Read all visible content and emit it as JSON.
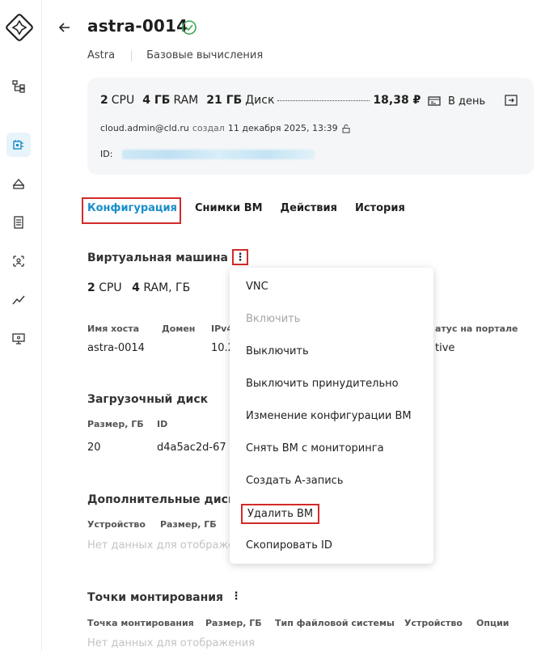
{
  "header": {
    "title": "astra-0014",
    "breadcrumb": [
      "Astra",
      "Базовые вычисления"
    ]
  },
  "summary": {
    "cpu_value": "2",
    "cpu_unit": "CPU",
    "ram_value": "4 ГБ",
    "ram_unit": "RAM",
    "disk_value": "21 ГБ",
    "disk_unit": "Диск",
    "price": "18,38 ₽",
    "period": "В день",
    "owner": "cloud.admin@cld.ru",
    "created_label": "создал",
    "created_date": "11 декабря 2025, 13:39",
    "id_label": "ID:"
  },
  "tabs": [
    {
      "label": "Конфигурация",
      "active": true
    },
    {
      "label": "Снимки ВМ",
      "active": false
    },
    {
      "label": "Действия",
      "active": false
    },
    {
      "label": "История",
      "active": false
    }
  ],
  "vm": {
    "heading": "Виртуальная машина",
    "cpu_value": "2",
    "cpu_unit": "CPU",
    "ram_value": "4",
    "ram_unit": "RAM, ГБ",
    "columns": [
      "Имя хоста",
      "Домен",
      "IPv4",
      "атус на портале"
    ],
    "host": "astra-0014",
    "ip": "10.2",
    "status": "tive"
  },
  "boot_disk": {
    "heading": "Загрузочный диск",
    "columns": [
      "Размер, ГБ",
      "ID"
    ],
    "size": "20",
    "id": "d4a5ac2d-67"
  },
  "extra_disks": {
    "heading": "Дополнительные диск",
    "columns": [
      "Устройство",
      "Размер, ГБ"
    ],
    "empty": "Нет данных для отображе"
  },
  "mounts": {
    "heading": "Точки монтирования",
    "columns": [
      "Точка монтирования",
      "Размер, ГБ",
      "Тип файловой системы",
      "Устройство",
      "Опции"
    ],
    "empty": "Нет данных для отображения"
  },
  "menu": [
    {
      "label": "VNC",
      "disabled": false
    },
    {
      "label": "Включить",
      "disabled": true
    },
    {
      "label": "Выключить",
      "disabled": false
    },
    {
      "label": "Выключить принудительно",
      "disabled": false
    },
    {
      "label": "Изменение конфигурации ВМ",
      "disabled": false
    },
    {
      "label": "Снять ВМ с мониторинга",
      "disabled": false
    },
    {
      "label": "Создать А-запись",
      "disabled": false
    },
    {
      "label": "Удалить ВМ",
      "disabled": false
    },
    {
      "label": "Скопировать ID",
      "disabled": false
    }
  ],
  "kebab_glyph": "⋮",
  "colors": {
    "accent": "#1a8ec9",
    "success": "#3aa655",
    "highlight": "#d32a2a"
  }
}
